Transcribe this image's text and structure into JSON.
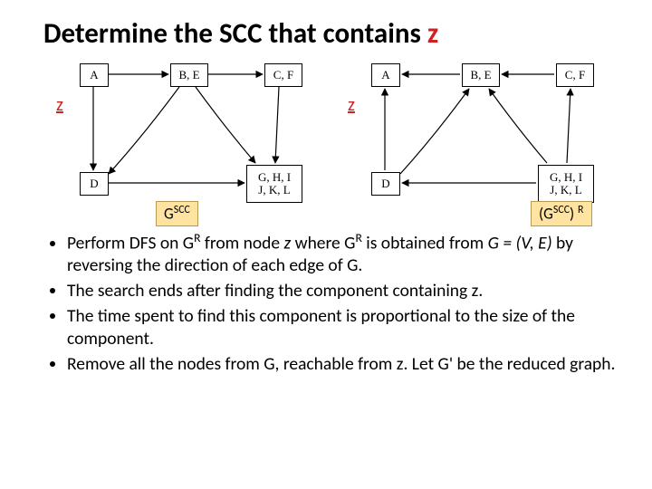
{
  "title_prefix": "Determine the SCC that contains ",
  "title_z": "z",
  "nodes": {
    "a": "A",
    "be": "B, E",
    "cf": "C, F",
    "d": "D",
    "ghi_line1": "G, H, I",
    "ghi_line2": "J, K, L"
  },
  "z_marker": "z",
  "captions": {
    "left_g": "G",
    "left_sup": "SCC",
    "right_open": "(G",
    "right_sup1": "SCC",
    "right_close": ") ",
    "right_sup2": "R"
  },
  "bullets": [
    {
      "pre": "Perform DFS on G",
      "sup1": "R",
      "mid1": " from node ",
      "ital_z": "z",
      "mid2": " where G",
      "sup2": "R",
      "mid3": " is obtained from ",
      "ital_eq": "G = (V, E)",
      "post": " by reversing the direction of each edge of G."
    },
    {
      "text": "The search ends after finding the component containing z."
    },
    {
      "text": "The time spent to find this component is proportional to the size of the component."
    },
    {
      "text": "Remove all the nodes from G, reachable from z. Let G' be the reduced graph."
    }
  ]
}
